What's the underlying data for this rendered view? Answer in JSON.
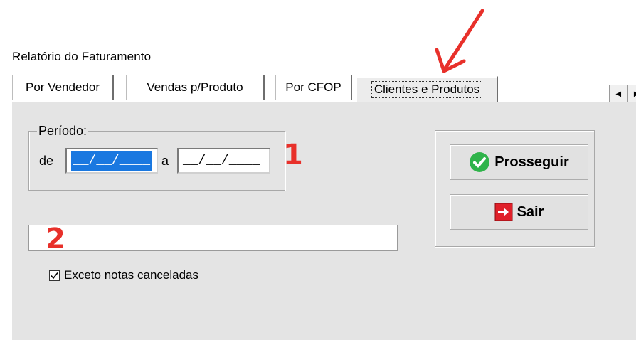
{
  "window": {
    "title": "Relatório do Faturamento"
  },
  "tabs": [
    {
      "label": "Por Vendedor",
      "active": false
    },
    {
      "label": "Vendas p/Produto",
      "active": false
    },
    {
      "label": "Por CFOP",
      "active": false
    },
    {
      "label": "Clientes e Produtos",
      "active": true
    }
  ],
  "tab_scroll": {
    "left_icon": "triangle-left-icon",
    "right_icon": "triangle-right-icon"
  },
  "periodo": {
    "label": "Período:",
    "from_label": "de",
    "from_value": "__/__/____",
    "to_label": "a",
    "to_value": "__/__/____"
  },
  "text_field": {
    "value": ""
  },
  "checkbox": {
    "label": "Exceto notas canceladas",
    "checked": true
  },
  "buttons": {
    "prosseguir": {
      "label": "Prosseguir",
      "icon": "check-circle-icon",
      "icon_color": "#2fb34a"
    },
    "sair": {
      "label": "Sair",
      "icon": "exit-arrow-icon",
      "icon_color": "#e0202a"
    }
  },
  "annotations": {
    "marker_1": "1",
    "marker_2": "2",
    "color": "#e8302a"
  }
}
